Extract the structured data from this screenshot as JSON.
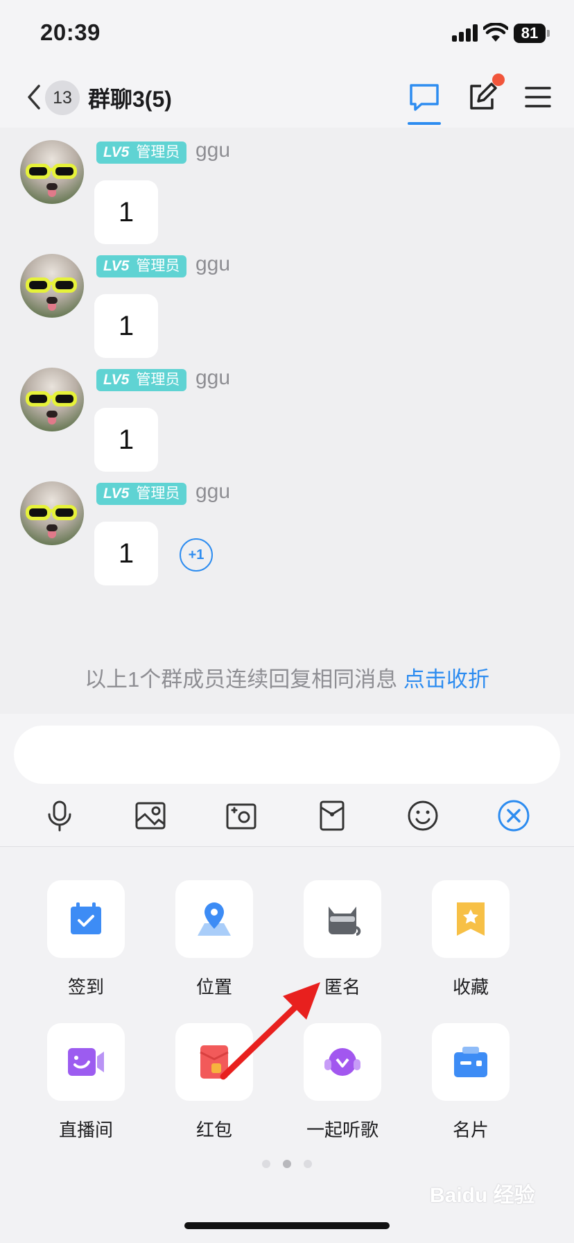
{
  "status_bar": {
    "time": "20:39",
    "battery": "81"
  },
  "nav": {
    "unread_count": "13",
    "title": "群聊3(5)"
  },
  "messages": [
    {
      "level": "LV5",
      "role": "管理员",
      "sender": "ggu",
      "text": "1"
    },
    {
      "level": "LV5",
      "role": "管理员",
      "sender": "ggu",
      "text": "1"
    },
    {
      "level": "LV5",
      "role": "管理员",
      "sender": "ggu",
      "text": "1"
    },
    {
      "level": "LV5",
      "role": "管理员",
      "sender": "ggu",
      "text": "1",
      "reaction": "+1"
    }
  ],
  "collapse": {
    "note": "以上1个群成员连续回复相同消息 ",
    "link": "点击收折"
  },
  "input": {
    "value": "",
    "placeholder": ""
  },
  "toolbar": [
    "mic-icon",
    "image-icon",
    "camera-icon",
    "red-packet-icon",
    "emoji-icon",
    "close-panel-icon"
  ],
  "apps": [
    {
      "label": "签到",
      "icon": "checkin-icon"
    },
    {
      "label": "位置",
      "icon": "location-icon"
    },
    {
      "label": "匿名",
      "icon": "anonymous-icon"
    },
    {
      "label": "收藏",
      "icon": "favorite-icon"
    },
    {
      "label": "直播间",
      "icon": "live-room-icon"
    },
    {
      "label": "红包",
      "icon": "red-packet-icon"
    },
    {
      "label": "一起听歌",
      "icon": "listen-together-icon"
    },
    {
      "label": "名片",
      "icon": "business-card-icon"
    }
  ],
  "pager": {
    "pages": 3,
    "current": 2
  },
  "colors": {
    "accent": "#2d8cf0",
    "level_badge": "#5fd3d3",
    "notify_dot": "#f1553b",
    "annotation_arrow": "#e8201e"
  },
  "watermark": "Baidu 经验"
}
